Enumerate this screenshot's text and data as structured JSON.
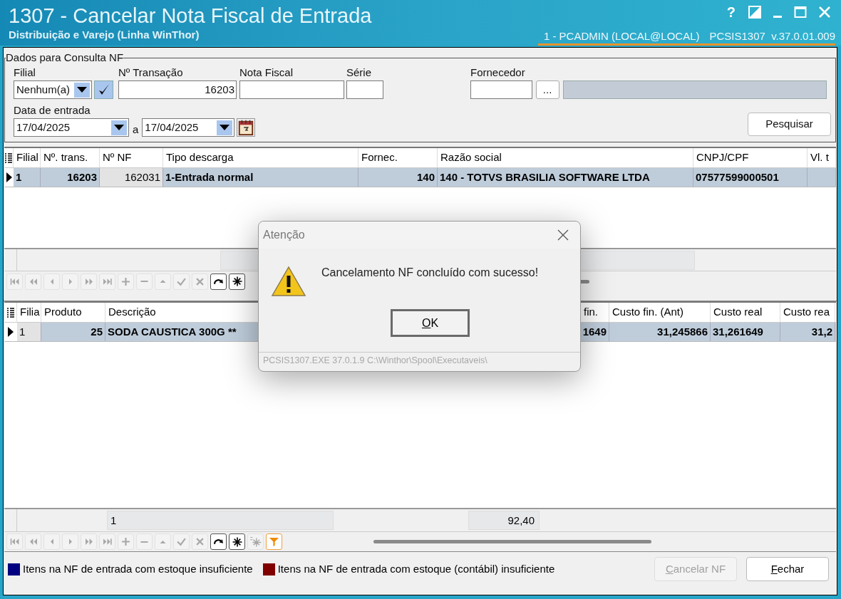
{
  "window": {
    "title": "1307 - Cancelar Nota Fiscal de Entrada",
    "subtitle": "Distribuição e Varejo (Linha WinThor)",
    "help_label": "?",
    "user": "1 - PCADMIN (LOCAL@LOCAL)",
    "version": "PCSIS1307  v.37.0.01.009"
  },
  "filter_group": {
    "title": "Dados para Consulta NF",
    "filial": {
      "label": "Filial",
      "value": "Nenhum(a)"
    },
    "transacao": {
      "label": "Nº Transação",
      "value": "16203"
    },
    "nota_fiscal": {
      "label": "Nota Fiscal"
    },
    "serie": {
      "label": "Série"
    },
    "fornecedor": {
      "label": "Fornecedor",
      "browse_label": "..."
    },
    "data_entrada": {
      "label": "Data de entrada",
      "from": "17/04/2025",
      "separator": "a",
      "to": "17/04/2025"
    },
    "search_button": "Pesquisar"
  },
  "grid_notas": {
    "columns": [
      "Filial",
      "Nº. trans.",
      "Nº NF",
      "Tipo descarga",
      "Fornec.",
      "Razão social",
      "CNPJ/CPF",
      "Vl. t"
    ],
    "rows": [
      {
        "selected": true,
        "cells": [
          "1",
          "16203",
          "162031",
          "1-Entrada normal",
          "140",
          "140 - TOTVS BRASILIA SOFTWARE LTDA",
          "07577599000501",
          null
        ]
      }
    ],
    "toolbar": [
      {
        "kind": "first",
        "disabled": true
      },
      {
        "kind": "prior_page",
        "disabled": true
      },
      {
        "kind": "prior",
        "disabled": true
      },
      {
        "kind": "next",
        "disabled": true
      },
      {
        "kind": "next_page",
        "disabled": true
      },
      {
        "kind": "last",
        "disabled": true
      },
      {
        "kind": "insert",
        "disabled": true
      },
      {
        "kind": "delete",
        "disabled": true
      },
      {
        "kind": "edit",
        "disabled": true
      },
      {
        "kind": "post",
        "disabled": true
      },
      {
        "kind": "cancel",
        "disabled": true
      },
      {
        "kind": "refresh",
        "disabled": false
      },
      {
        "kind": "asterisk",
        "disabled": false
      }
    ]
  },
  "grid_itens": {
    "columns": [
      "Filia",
      "Produto",
      "Descrição",
      "fin.",
      "Custo fin. (Ant)",
      "Custo real",
      "Custo rea"
    ],
    "rows": [
      {
        "selected": true,
        "cells": [
          "1",
          "25",
          "SODA CAUSTICA 300G **",
          "1649",
          "31,245866",
          "31,261649",
          "31,2"
        ]
      }
    ],
    "footer": [
      "1",
      "92,40"
    ],
    "toolbar": [
      {
        "kind": "first",
        "disabled": true
      },
      {
        "kind": "prior_page",
        "disabled": true
      },
      {
        "kind": "prior",
        "disabled": true
      },
      {
        "kind": "next",
        "disabled": true
      },
      {
        "kind": "next_page",
        "disabled": true
      },
      {
        "kind": "last",
        "disabled": true
      },
      {
        "kind": "insert",
        "disabled": true
      },
      {
        "kind": "delete",
        "disabled": true
      },
      {
        "kind": "edit",
        "disabled": true
      },
      {
        "kind": "post",
        "disabled": true
      },
      {
        "kind": "cancel",
        "disabled": true
      },
      {
        "kind": "refresh",
        "disabled": false
      },
      {
        "kind": "asterisk",
        "disabled": false
      },
      {
        "kind": "asterisk_all",
        "disabled": true
      },
      {
        "kind": "filter",
        "disabled": false
      }
    ]
  },
  "legend": [
    {
      "label": "Itens na NF de entrada com estoque insuficiente",
      "color": "#000080"
    },
    {
      "label": "Itens na NF de entrada com estoque (contábil) insuficiente",
      "color": "#800000"
    }
  ],
  "buttons": [
    {
      "label": "Cancelar NF",
      "disabled": true
    },
    {
      "label": "Fechar",
      "disabled": false
    }
  ],
  "dialog": {
    "title": "Atenção",
    "message": "Cancelamento NF concluído com sucesso!",
    "button": "OK",
    "footer": "PCSIS1307.EXE 37.0.1.9 C:\\Winthor\\Spool\\Executaveis\\"
  }
}
